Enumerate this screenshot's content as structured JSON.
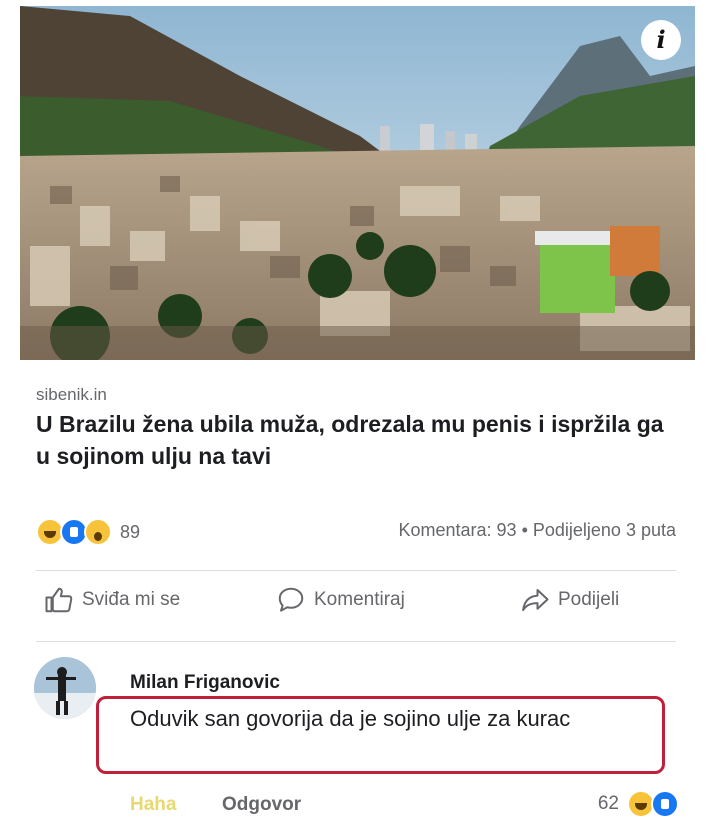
{
  "post": {
    "info_icon": "info-icon",
    "source": "sibenik.in",
    "headline": "U Brazilu žena ubila muža, odrezala mu penis i ispržila ga u sojinom ulju na tavi"
  },
  "stats": {
    "reactions": [
      "haha",
      "like",
      "wow"
    ],
    "reaction_count": "89",
    "comments_shares": "Komentara: 93 • Podijeljeno 3 puta"
  },
  "actions": {
    "like": "Sviđa mi se",
    "comment": "Komentiraj",
    "share": "Podijeli"
  },
  "comment": {
    "author": "Milan Friganovic",
    "text": "Oduvik san govorija da je sojino ulje za kurac",
    "haha_label": "Haha",
    "reply_label": "Odgovor",
    "reaction_count": "62",
    "reactions": [
      "haha",
      "like"
    ]
  },
  "colors": {
    "highlight_border": "#c0203a",
    "fb_blue": "#1877f2",
    "haha_yellow": "#f7c33b"
  }
}
